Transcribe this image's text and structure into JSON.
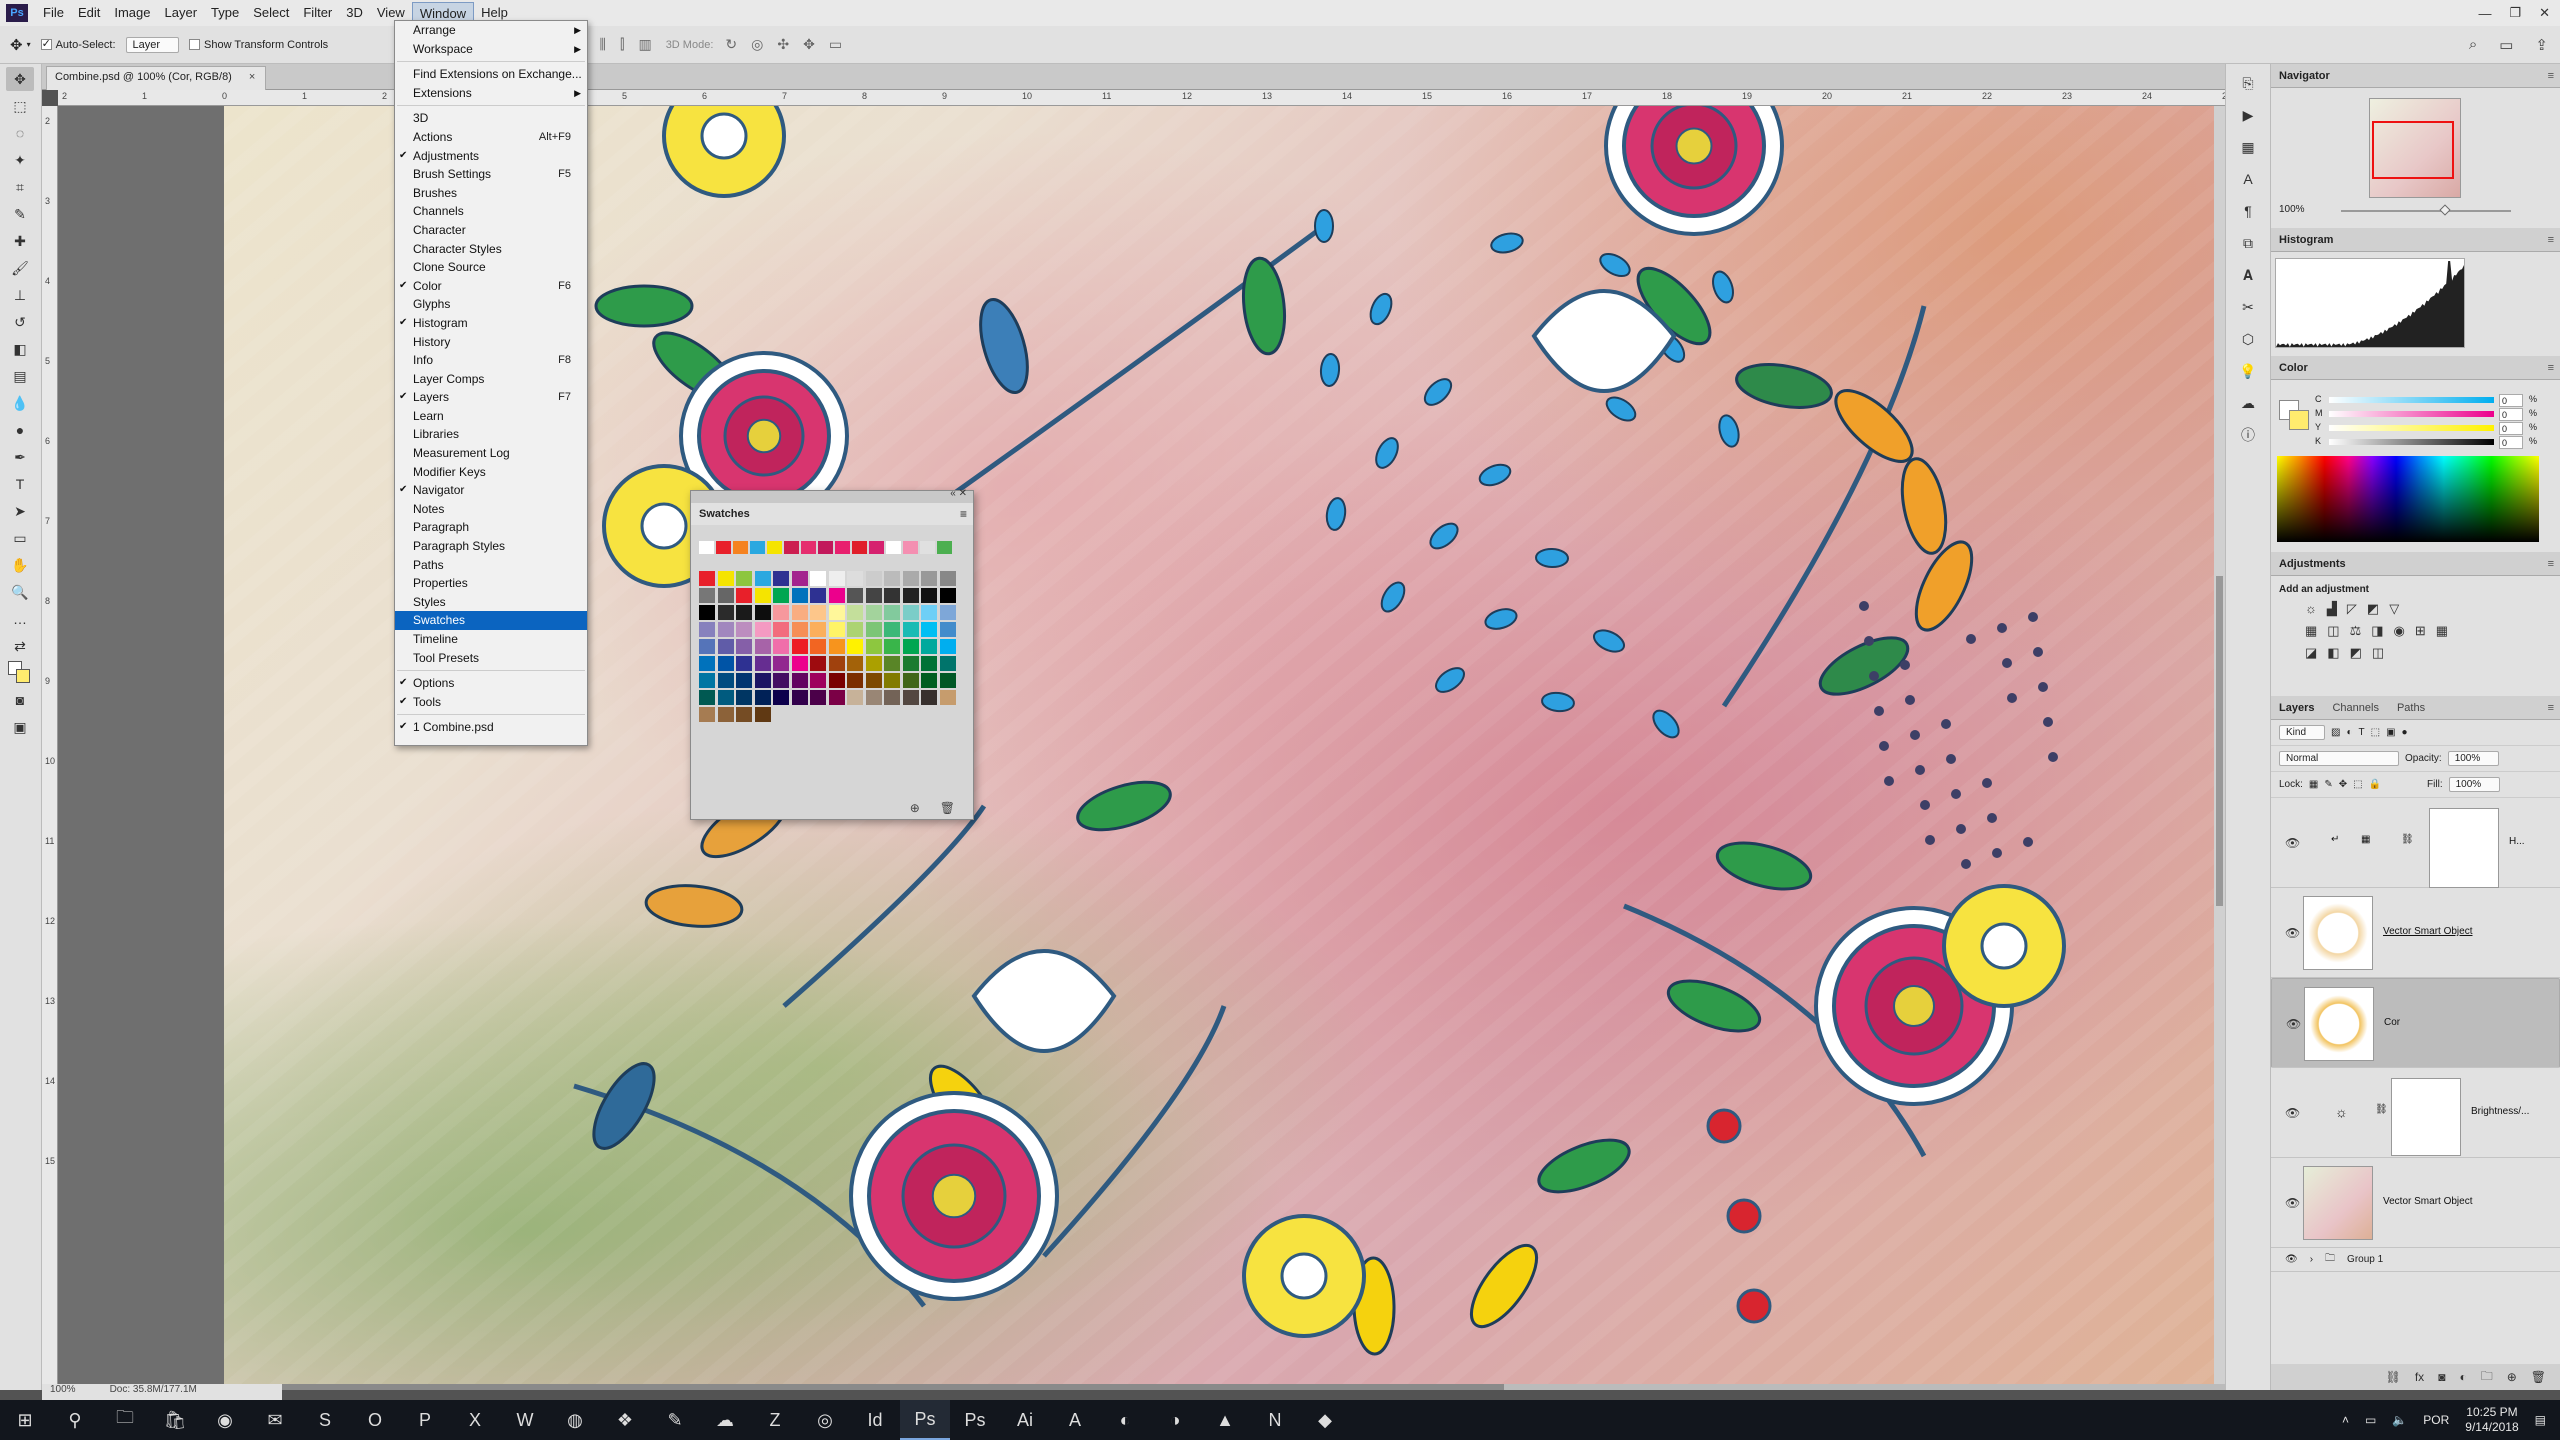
{
  "menubar": {
    "app_logo": "Ps",
    "items": [
      "File",
      "Edit",
      "Image",
      "Layer",
      "Type",
      "Select",
      "Filter",
      "3D",
      "View",
      "Window",
      "Help"
    ],
    "active": "Window"
  },
  "options": {
    "auto_select_label": "Auto-Select:",
    "auto_select_value": "Layer",
    "transform_label": "Show Transform Controls",
    "mode_label": "3D Mode:"
  },
  "doc_tab": {
    "title": "Combine.psd @ 100% (Cor, RGB/8)"
  },
  "ruler": {
    "h": [
      "2",
      "1",
      "0",
      "1",
      "2",
      "3",
      "4",
      "5",
      "6",
      "7",
      "8",
      "9",
      "10",
      "11",
      "12",
      "13",
      "14",
      "15",
      "16",
      "17",
      "18",
      "19",
      "20",
      "21",
      "22",
      "23",
      "24",
      "25"
    ],
    "v": [
      "2",
      "3",
      "4",
      "5",
      "6",
      "7",
      "8",
      "9",
      "10",
      "11",
      "12",
      "13",
      "14",
      "15"
    ]
  },
  "status": {
    "zoom": "100%",
    "doc": "Doc: 35.8M/177.1M"
  },
  "window_menu": {
    "items": [
      {
        "label": "Arrange",
        "sub": true
      },
      {
        "label": "Workspace",
        "sub": true
      },
      {
        "sep": true
      },
      {
        "label": "Find Extensions on Exchange..."
      },
      {
        "label": "Extensions",
        "sub": true
      },
      {
        "sep": true
      },
      {
        "label": "3D"
      },
      {
        "label": "Actions",
        "shortcut": "Alt+F9"
      },
      {
        "label": "Adjustments",
        "checked": true
      },
      {
        "label": "Brush Settings",
        "shortcut": "F5"
      },
      {
        "label": "Brushes"
      },
      {
        "label": "Channels"
      },
      {
        "label": "Character"
      },
      {
        "label": "Character Styles"
      },
      {
        "label": "Clone Source"
      },
      {
        "label": "Color",
        "checked": true,
        "shortcut": "F6"
      },
      {
        "label": "Glyphs"
      },
      {
        "label": "Histogram",
        "checked": true
      },
      {
        "label": "History"
      },
      {
        "label": "Info",
        "shortcut": "F8"
      },
      {
        "label": "Layer Comps"
      },
      {
        "label": "Layers",
        "checked": true,
        "shortcut": "F7"
      },
      {
        "label": "Learn"
      },
      {
        "label": "Libraries"
      },
      {
        "label": "Measurement Log"
      },
      {
        "label": "Modifier Keys"
      },
      {
        "label": "Navigator",
        "checked": true
      },
      {
        "label": "Notes"
      },
      {
        "label": "Paragraph"
      },
      {
        "label": "Paragraph Styles"
      },
      {
        "label": "Paths"
      },
      {
        "label": "Properties"
      },
      {
        "label": "Styles"
      },
      {
        "label": "Swatches",
        "highlighted": true
      },
      {
        "label": "Timeline"
      },
      {
        "label": "Tool Presets"
      },
      {
        "sep": true
      },
      {
        "label": "Options",
        "checked": true
      },
      {
        "label": "Tools",
        "checked": true
      },
      {
        "sep": true
      },
      {
        "label": "1 Combine.psd",
        "checked": true
      }
    ]
  },
  "swatches": {
    "title": "Swatches",
    "recent": [
      "#ffffff",
      "#e8202a",
      "#f58220",
      "#2aa8e0",
      "#f5e400",
      "#cc1e50",
      "#e52d6e",
      "#c2185b",
      "#e8206e",
      "#e01e2a",
      "#d6226f",
      "#ffffff",
      "#f48fb1",
      "#e0e0e0",
      "#4caf50"
    ],
    "grid": [
      "#e8202a",
      "#f5e400",
      "#8dc63f",
      "#2aa8e0",
      "#2e3192",
      "#a3238e",
      "#ffffff",
      "#eeeeee",
      "#dddddd",
      "#cccccc",
      "#bbbbbb",
      "#aaaaaa",
      "#999999",
      "#888888",
      "#777777",
      "#666666",
      "#e8202a",
      "#f5e400",
      "#00a651",
      "#0072bc",
      "#2e3192",
      "#ec008c",
      "#555555",
      "#444444",
      "#333333",
      "#222222",
      "#111111",
      "#000000",
      "#000000",
      "#2b2b2b",
      "#1a1a1a",
      "#0d0d0d",
      "#f6989d",
      "#f9ad81",
      "#fdc68a",
      "#fff79a",
      "#c4df9b",
      "#a3d39c",
      "#82ca9d",
      "#7bcdc8",
      "#6ecff6",
      "#7ea7d8",
      "#8781bd",
      "#a187be",
      "#bc8dbf",
      "#f49ac2",
      "#f26d7d",
      "#f68e56",
      "#fbaf5c",
      "#fff467",
      "#acd372",
      "#7cc576",
      "#3bb878",
      "#1abbb4",
      "#00bff3",
      "#438ccb",
      "#5574b9",
      "#605ca8",
      "#855fa8",
      "#a763a8",
      "#f06eaa",
      "#ed1c24",
      "#f26522",
      "#f7941d",
      "#fff200",
      "#8dc73f",
      "#39b54a",
      "#00a651",
      "#00a99d",
      "#00aeef",
      "#0072bc",
      "#0054a6",
      "#2e3192",
      "#662d91",
      "#92278f",
      "#ec008c",
      "#9e0b0f",
      "#a0410d",
      "#a36209",
      "#aba000",
      "#598527",
      "#1a7b30",
      "#007236",
      "#00746b",
      "#0076a3",
      "#004b80",
      "#003471",
      "#1b1464",
      "#440e62",
      "#630460",
      "#9e005d",
      "#790000",
      "#7b2e00",
      "#7d4900",
      "#827b00",
      "#406618",
      "#005e20",
      "#005826",
      "#005952",
      "#005b7f",
      "#003663",
      "#002157",
      "#0d004c",
      "#32004b",
      "#4b0049",
      "#7b0046",
      "#c7b299",
      "#998675",
      "#736357",
      "#534741",
      "#37302d",
      "#c69c6d",
      "#a67c52",
      "#8c6239",
      "#754c24",
      "#603913"
    ]
  },
  "panels": {
    "navigator": {
      "title": "Navigator",
      "zoom": "100%"
    },
    "histogram": {
      "title": "Histogram"
    },
    "color": {
      "title": "Color",
      "channels": [
        {
          "name": "C",
          "value": "0"
        },
        {
          "name": "M",
          "value": "0"
        },
        {
          "name": "Y",
          "value": "0"
        },
        {
          "name": "K",
          "value": "0"
        }
      ],
      "pct": "%",
      "fg": "#ffffff",
      "bg": "#ffeb6e"
    },
    "adjustments": {
      "title": "Adjustments",
      "subtitle": "Add an adjustment"
    },
    "layers": {
      "tabs": [
        "Layers",
        "Channels",
        "Paths"
      ],
      "kind": "Kind",
      "blend": "Normal",
      "opacity_label": "Opacity:",
      "opacity": "100%",
      "lock_label": "Lock:",
      "fill_label": "Fill:",
      "fill": "100%",
      "rows": [
        {
          "name": "H..."
        },
        {
          "name": "Vector Smart Object"
        },
        {
          "name": "Cor"
        },
        {
          "name": "Brightness/..."
        },
        {
          "name": "Vector Smart Object"
        }
      ],
      "group": "Group 1"
    }
  },
  "taskbar": {
    "time": "10:25 PM",
    "date": "9/14/2018",
    "lang": "POR"
  }
}
